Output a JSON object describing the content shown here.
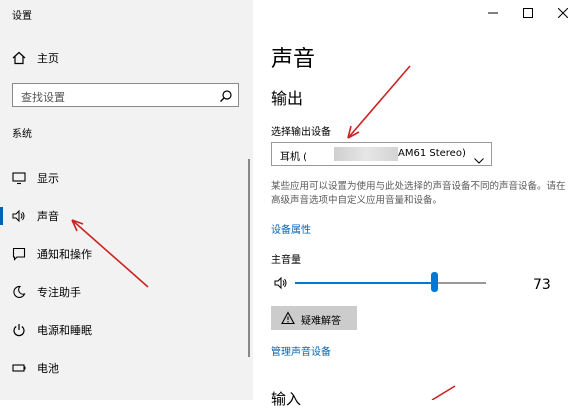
{
  "window": {
    "title": "设置"
  },
  "sidebar": {
    "home_label": "主页",
    "search_placeholder": "查找设置",
    "section_label": "系统",
    "items": [
      {
        "label": "显示",
        "icon": "monitor-icon"
      },
      {
        "label": "声音",
        "icon": "speaker-icon"
      },
      {
        "label": "通知和操作",
        "icon": "notification-icon"
      },
      {
        "label": "专注助手",
        "icon": "moon-icon"
      },
      {
        "label": "电源和睡眠",
        "icon": "power-icon"
      },
      {
        "label": "电池",
        "icon": "battery-icon"
      }
    ]
  },
  "main": {
    "title": "声音",
    "output_heading": "输出",
    "choose_output_label": "选择输出设备",
    "device_prefix": "耳机 (",
    "device_suffix": "AM61 Stereo)",
    "description": "某些应用可以设置为使用与此处选择的声音设备不同的声音设备。请在高级声音选项中自定义应用音量和设备。",
    "device_properties_link": "设备属性",
    "master_volume_label": "主音量",
    "volume_value": "73",
    "volume_level": 0.73,
    "troubleshoot_label": "疑难解答",
    "manage_devices_link": "管理声音设备",
    "input_heading": "输入"
  },
  "colors": {
    "accent": "#0078d7",
    "link": "#0066b4",
    "annotation_arrow": "#cc2222"
  }
}
